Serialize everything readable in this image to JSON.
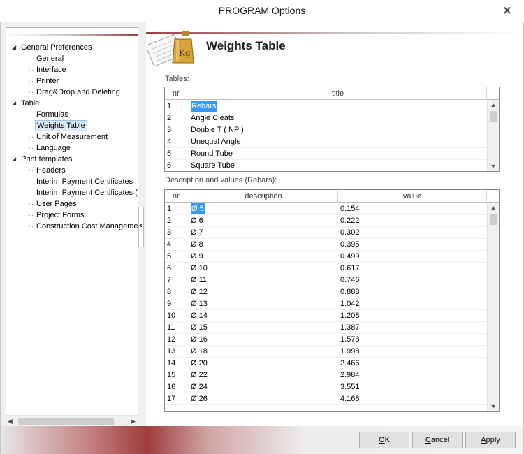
{
  "window": {
    "title": "PROGRAM Options",
    "close_glyph": "✕"
  },
  "tree": [
    {
      "label": "General Preferences",
      "level": 0,
      "expander": "◢"
    },
    {
      "label": "General",
      "level": 1
    },
    {
      "label": "Interface",
      "level": 1
    },
    {
      "label": "Printer",
      "level": 1
    },
    {
      "label": "Drag&Drop and Deleting",
      "level": 1
    },
    {
      "label": "Table",
      "level": 0,
      "expander": "◢"
    },
    {
      "label": "Formulas",
      "level": 1
    },
    {
      "label": "Weights Table",
      "level": 1,
      "selected": true
    },
    {
      "label": "Unit of Measurement",
      "level": 1
    },
    {
      "label": "Language",
      "level": 1
    },
    {
      "label": "Print templates",
      "level": 0,
      "expander": "◢"
    },
    {
      "label": "Headers",
      "level": 1
    },
    {
      "label": "Interim Payment Certificates",
      "level": 1
    },
    {
      "label": "Interim Payment Certificates (B",
      "level": 1
    },
    {
      "label": "User Pages",
      "level": 1
    },
    {
      "label": "Project Forms",
      "level": 1
    },
    {
      "label": "Construction Cost Managemen",
      "level": 1
    }
  ],
  "splitter_glyph": "‹",
  "page": {
    "title": "Weights Table",
    "icon": "weight-kg-icon",
    "icon_text": "Kg"
  },
  "tables": {
    "label": "Tables:",
    "columns": [
      "nr.",
      "title"
    ],
    "rows": [
      {
        "nr": "1",
        "title": "Rebars"
      },
      {
        "nr": "2",
        "title": "Angle Cleats"
      },
      {
        "nr": "3",
        "title": "Double T ( NP )"
      },
      {
        "nr": "4",
        "title": "Unequal Angle"
      },
      {
        "nr": "5",
        "title": "Round Tube"
      },
      {
        "nr": "6",
        "title": "Square Tube"
      }
    ]
  },
  "values": {
    "label": "Description and values (Rebars):",
    "columns": [
      "nr.",
      "description",
      "value"
    ],
    "rows": [
      {
        "nr": "1",
        "description": "Ø 5",
        "value": "0.154"
      },
      {
        "nr": "2",
        "description": "Ø 6",
        "value": "0.222"
      },
      {
        "nr": "3",
        "description": "Ø 7",
        "value": "0.302"
      },
      {
        "nr": "4",
        "description": "Ø 8",
        "value": "0.395"
      },
      {
        "nr": "5",
        "description": "Ø 9",
        "value": "0.499"
      },
      {
        "nr": "6",
        "description": "Ø 10",
        "value": "0.617"
      },
      {
        "nr": "7",
        "description": "Ø 11",
        "value": "0.746"
      },
      {
        "nr": "8",
        "description": "Ø 12",
        "value": "0.888"
      },
      {
        "nr": "9",
        "description": "Ø 13",
        "value": "1.042"
      },
      {
        "nr": "10",
        "description": "Ø 14",
        "value": "1.208"
      },
      {
        "nr": "11",
        "description": "Ø 15",
        "value": "1.387"
      },
      {
        "nr": "12",
        "description": "Ø 16",
        "value": "1.578"
      },
      {
        "nr": "13",
        "description": "Ø 18",
        "value": "1.998"
      },
      {
        "nr": "14",
        "description": "Ø 20",
        "value": "2.466"
      },
      {
        "nr": "15",
        "description": "Ø 22",
        "value": "2.984"
      },
      {
        "nr": "16",
        "description": "Ø 24",
        "value": "3.551"
      },
      {
        "nr": "17",
        "description": "Ø 26",
        "value": "4.168"
      }
    ]
  },
  "scroll": {
    "up": "▲",
    "down": "▼",
    "left": "◀",
    "right": "▶"
  },
  "buttons": {
    "ok": {
      "key": "O",
      "rest": "K"
    },
    "cancel": {
      "key": "C",
      "rest": "ancel"
    },
    "apply": {
      "key": "A",
      "rest": "pply"
    }
  },
  "colors": {
    "accent": "#9e3c3c",
    "selection": "#3399ff",
    "tree_selection": "#dbeaf9"
  }
}
